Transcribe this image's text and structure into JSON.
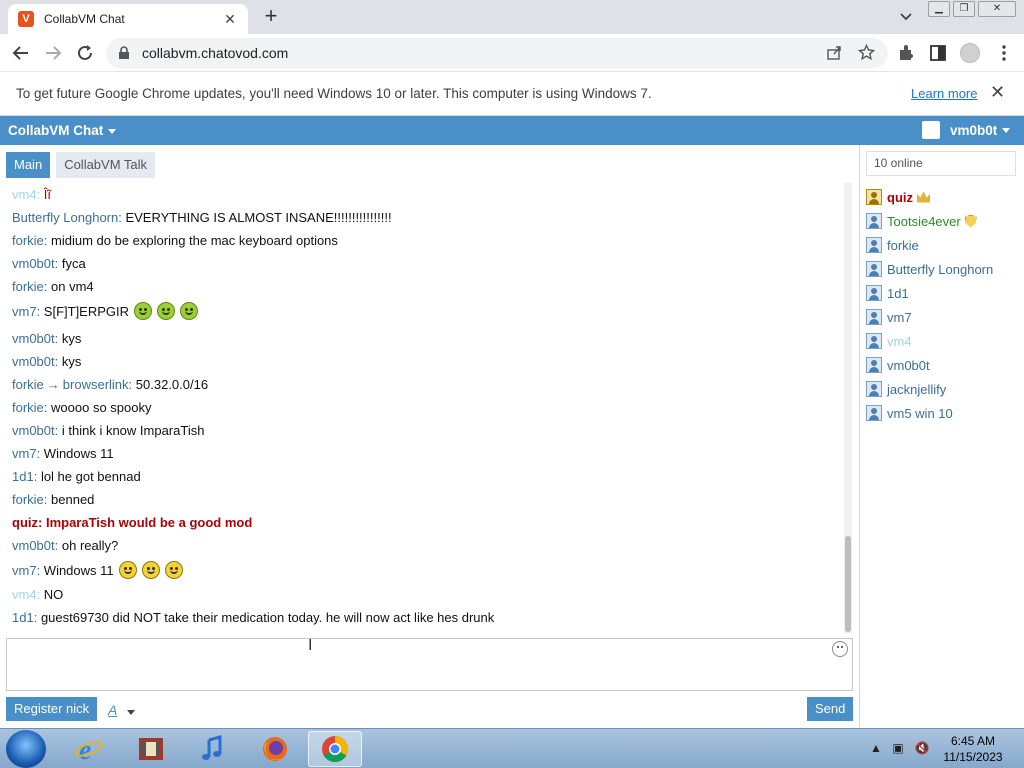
{
  "browser": {
    "tab_title": "CollabVM Chat",
    "favicon_letter": "V",
    "tab_close": "✕",
    "new_tab": "+",
    "url": "collabvm.chatovod.com"
  },
  "infobar": {
    "message": "To get future Google Chrome updates, you'll need Windows 10 or later. This computer is using Windows 7.",
    "learn_more": "Learn more",
    "close": "✕"
  },
  "app": {
    "brand": "CollabVM Chat",
    "username": "vm0b0t",
    "tabs": [
      "Main",
      "CollabVM Talk"
    ]
  },
  "messages": [
    {
      "nick": "vm4",
      "text": "Îĩ",
      "style": "dim-red"
    },
    {
      "nick": "Butterfly Longhorn",
      "text": "EVERYTHING IS ALMOST INSANE!!!!!!!!!!!!!!!!"
    },
    {
      "nick": "forkie",
      "text": "midium do be exploring the mac keyboard options"
    },
    {
      "nick": "vm0b0t",
      "text": "fyca"
    },
    {
      "nick": "forkie",
      "text": "on vm4"
    },
    {
      "nick": "vm7",
      "text": "S[F]T]ERPGIR",
      "emoji": "sick",
      "emoji_count": 3
    },
    {
      "nick": "vm0b0t",
      "text": "kys"
    },
    {
      "nick": "vm0b0t",
      "text": "kys"
    },
    {
      "nick": "forkie",
      "to": "browserlink",
      "text": "50.32.0.0/16"
    },
    {
      "nick": "forkie",
      "text": "woooo so spooky"
    },
    {
      "nick": "vm0b0t",
      "text": "i think i know ImparaTish"
    },
    {
      "nick": "vm7",
      "text": "Windows 11"
    },
    {
      "nick": "1d1",
      "text": "lol he got bennad"
    },
    {
      "nick": "forkie",
      "text": "benned"
    },
    {
      "nick": "quiz",
      "text": "ImparaTish would be a good mod",
      "style": "mod"
    },
    {
      "nick": "vm0b0t",
      "text": "oh really?"
    },
    {
      "nick": "vm7",
      "text": "Windows 11",
      "emoji": "smile",
      "emoji_count": 3
    },
    {
      "nick": "vm4",
      "text": "NO",
      "style": "dim"
    },
    {
      "nick": "1d1",
      "text": "guest69730 did NOT take their medication today. he will now act like hes drunk"
    }
  ],
  "composer": {
    "register_label": "Register nick",
    "format_label": "A",
    "send_label": "Send"
  },
  "users": {
    "online_label": "10 online",
    "list": [
      {
        "name": "quiz",
        "style": "mod",
        "badge": "crown"
      },
      {
        "name": "Tootsie4ever",
        "style": "green",
        "badge": "shield"
      },
      {
        "name": "forkie"
      },
      {
        "name": "Butterfly Longhorn"
      },
      {
        "name": "1d1"
      },
      {
        "name": "vm7"
      },
      {
        "name": "vm4",
        "style": "dim"
      },
      {
        "name": "vm0b0t"
      },
      {
        "name": "jacknjellify"
      },
      {
        "name": "vm5 win 10"
      }
    ]
  },
  "taskbar": {
    "time": "6:45 AM",
    "date": "11/15/2023",
    "apps": [
      "internet-explorer",
      "media-center",
      "itunes",
      "firefox",
      "chrome"
    ]
  },
  "colors": {
    "accent": "#4a8fc7",
    "nick": "#3b6e99",
    "mod": "#b00000",
    "dim": "#9fd5e6",
    "green": "#2c8a2c"
  }
}
